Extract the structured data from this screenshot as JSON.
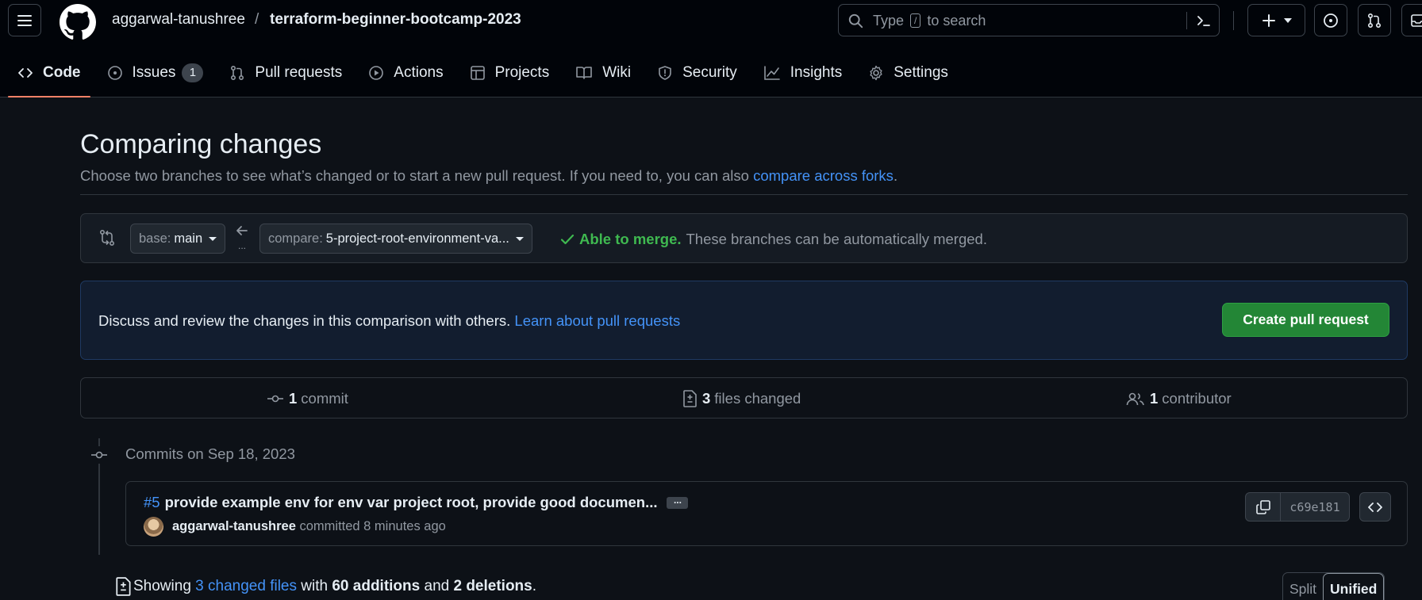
{
  "header": {
    "owner": "aggarwal-tanushree",
    "separator": "/",
    "repo": "terraform-beginner-bootcamp-2023",
    "search_prefix": "Type",
    "search_key": "/",
    "search_suffix": "to search"
  },
  "tabs": [
    {
      "label": "Code",
      "icon": "code-icon",
      "selected": true
    },
    {
      "label": "Issues",
      "icon": "issue-opened-icon",
      "count": "1"
    },
    {
      "label": "Pull requests",
      "icon": "git-pull-request-icon"
    },
    {
      "label": "Actions",
      "icon": "play-icon"
    },
    {
      "label": "Projects",
      "icon": "table-icon"
    },
    {
      "label": "Wiki",
      "icon": "book-icon"
    },
    {
      "label": "Security",
      "icon": "shield-icon"
    },
    {
      "label": "Insights",
      "icon": "graph-icon"
    },
    {
      "label": "Settings",
      "icon": "gear-icon"
    }
  ],
  "page": {
    "title": "Comparing changes",
    "subtitle_text": "Choose two branches to see what’s changed or to start a new pull request. If you need to, you can also",
    "subtitle_link": "compare across forks",
    "subtitle_end": "."
  },
  "range": {
    "base_prefix": "base:",
    "base_branch": "main",
    "compare_prefix": "compare:",
    "compare_branch": "5-project-root-environment-va...",
    "merge_status": "Able to merge.",
    "merge_text": "These branches can be automatically merged."
  },
  "blankslate": {
    "text": "Discuss and review the changes in this comparison with others.",
    "link": "Learn about pull requests",
    "button": "Create pull request"
  },
  "summary": {
    "commits_count": "1",
    "commits_label": "commit",
    "files_count": "3",
    "files_label": "files changed",
    "contributors_count": "1",
    "contributors_label": "contributor"
  },
  "commits": {
    "date_heading": "Commits on Sep 18, 2023",
    "items": [
      {
        "pr": "#5",
        "message": "provide example env for env var project root, provide good documen...",
        "author": "aggarwal-tanushree",
        "action": "committed 8 minutes ago",
        "sha": "c69e181",
        "ellipsis": "..."
      }
    ]
  },
  "files": {
    "showing": "Showing",
    "changed_link": "3 changed files",
    "with": "with",
    "additions": "60 additions",
    "and": "and",
    "deletions": "2 deletions",
    "end": ".",
    "split_label": "Split",
    "unified_label": "Unified"
  },
  "colors": {
    "bg": "#0d1117",
    "accent_link": "#4493f8",
    "success": "#3fb950",
    "primary_button": "#238636",
    "selected_tab_underline": "#f78166"
  }
}
